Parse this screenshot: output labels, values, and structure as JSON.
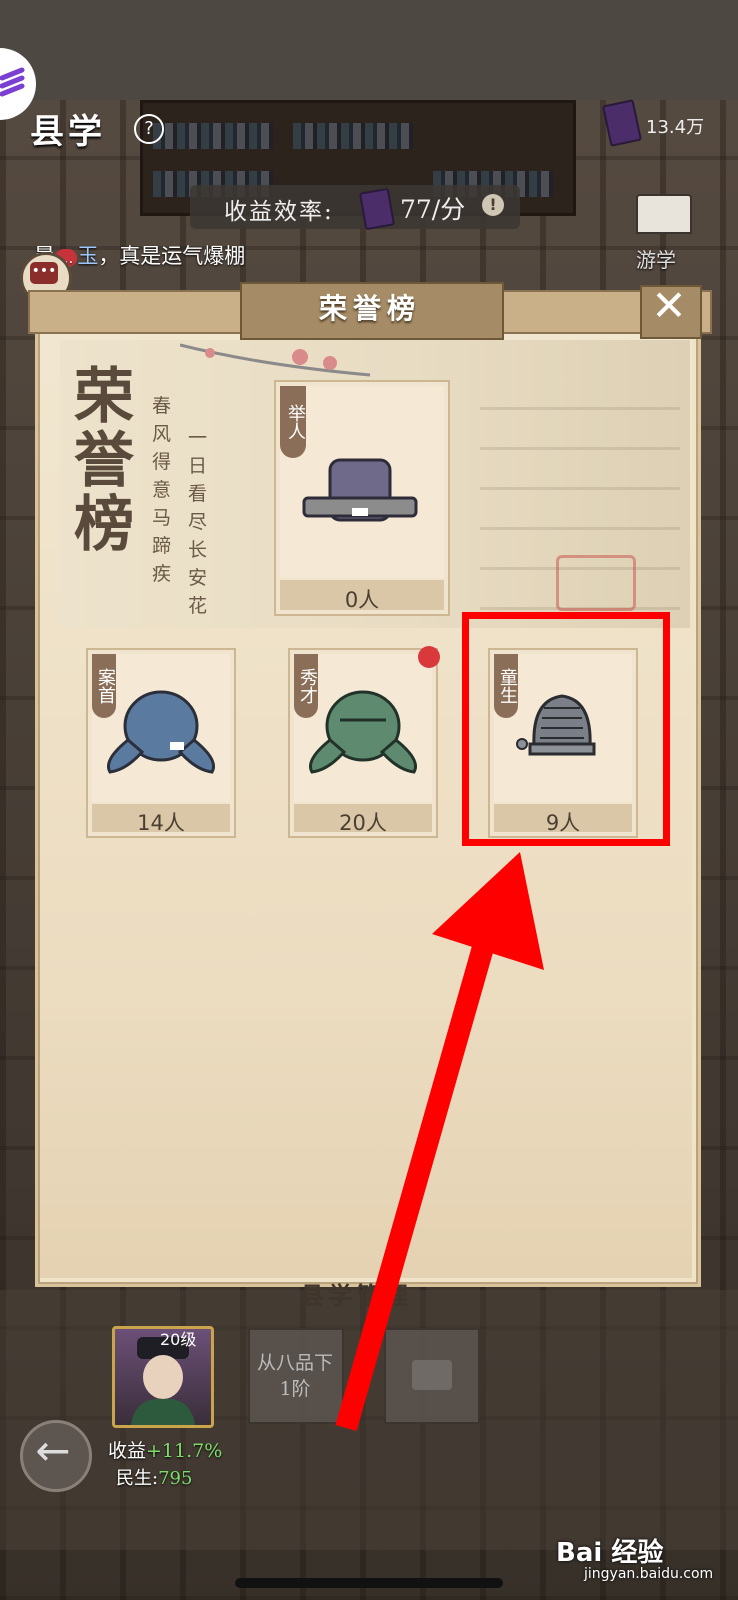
{
  "header": {
    "title": "县学",
    "coins": "13.4万",
    "rate_label": "收益效率:",
    "rate_value": "77/分",
    "tour_label": "游学"
  },
  "chat": {
    "prefix": "暑",
    "masked": "...",
    "name": "玉",
    "message": "，真是运气爆棚"
  },
  "dialog": {
    "title": "荣誉榜",
    "banner_title": "荣誉榜",
    "poem_line1": "春风得意马蹄疾",
    "poem_line2": "一日看尽长安花",
    "cards": [
      {
        "tag": "举人",
        "count": "0人"
      },
      {
        "tag": "案首",
        "count": "14人"
      },
      {
        "tag": "秀才",
        "count": "20人"
      },
      {
        "tag": "童生",
        "count": "9人"
      }
    ]
  },
  "bottom": {
    "section_label": "县学管理",
    "level": "20级",
    "profit_label": "收益",
    "profit_value": "+11.7%",
    "people_label": "民生:",
    "people_value": "795",
    "rank_button": "从八品下1阶"
  },
  "watermark": {
    "brand": "Bai 经验",
    "url": "jingyan.baidu.com"
  },
  "colors": {
    "highlight": "#ff0000",
    "arrow": "#ff0000"
  }
}
